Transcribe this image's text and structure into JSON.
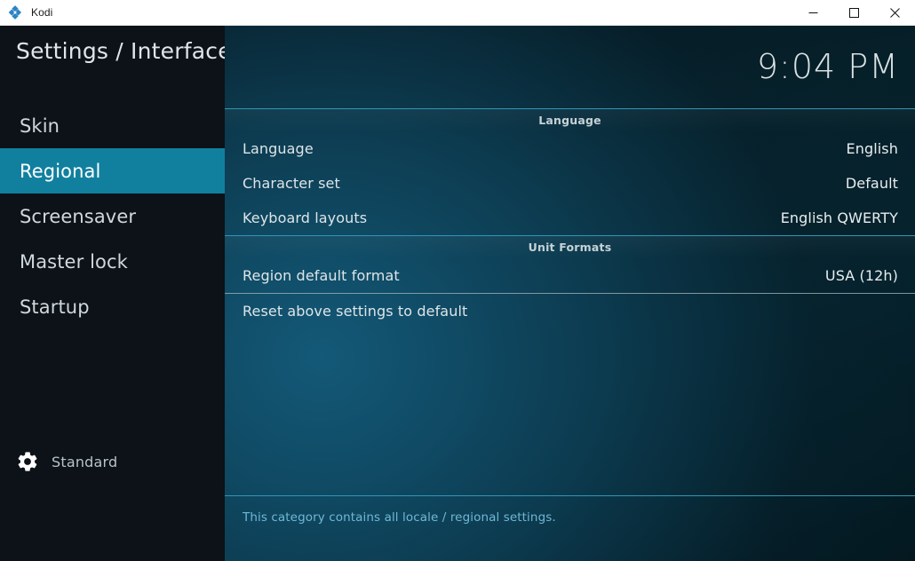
{
  "window": {
    "app_name": "Kodi",
    "logo_icon": "kodi-logo-icon",
    "minimize_label": "Minimize",
    "maximize_label": "Maximize",
    "close_label": "Close"
  },
  "sidebar": {
    "page_title": "Settings / Interface",
    "items": [
      {
        "label": "Skin",
        "selected": false
      },
      {
        "label": "Regional",
        "selected": true
      },
      {
        "label": "Screensaver",
        "selected": false
      },
      {
        "label": "Master lock",
        "selected": false
      },
      {
        "label": "Startup",
        "selected": false
      }
    ],
    "level": {
      "icon": "gear-icon",
      "label": "Standard"
    }
  },
  "content": {
    "clock": "9:04 PM",
    "groups": [
      {
        "header": "Language",
        "rows": [
          {
            "label": "Language",
            "value": "English"
          },
          {
            "label": "Character set",
            "value": "Default"
          },
          {
            "label": "Keyboard layouts",
            "value": "English QWERTY"
          }
        ]
      },
      {
        "header": "Unit Formats",
        "rows": [
          {
            "label": "Region default format",
            "value": "USA (12h)"
          }
        ]
      }
    ],
    "reset_row": {
      "label": "Reset above settings to default",
      "value": ""
    },
    "footer_text": "This category contains all locale / regional settings."
  },
  "colors": {
    "accent": "#11809f",
    "rule_line": "#2f97b4",
    "footer_text": "#6fb8d6",
    "sidebar_bg": "#0c1217"
  }
}
